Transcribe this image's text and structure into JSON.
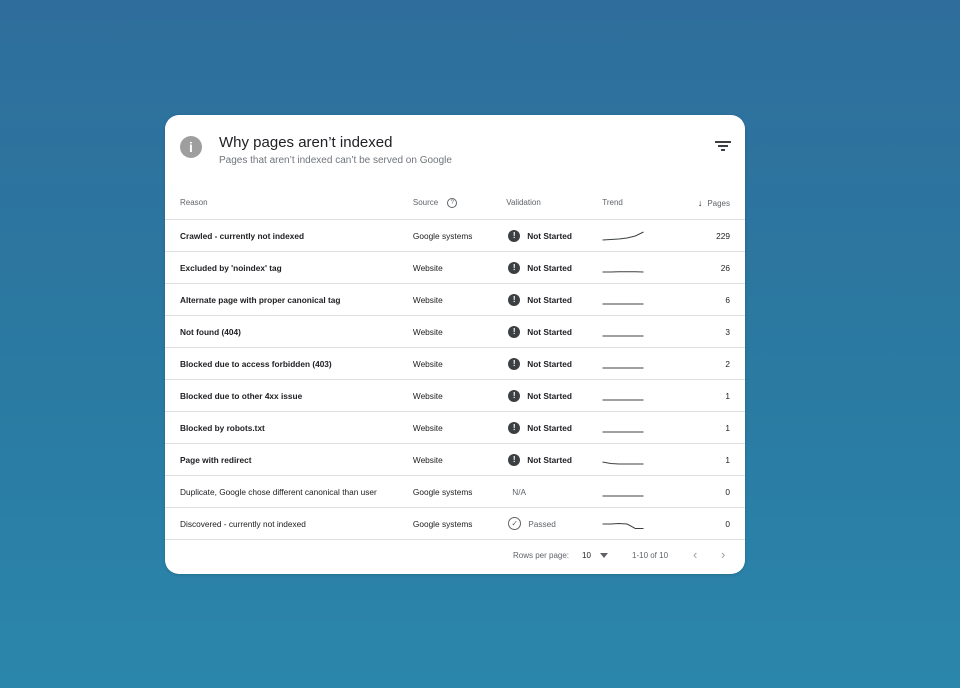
{
  "card": {
    "title": "Why pages aren’t indexed",
    "subtitle": "Pages that aren’t indexed can’t be served on Google",
    "info_icon": "info-icon",
    "filter_icon": "filter-icon"
  },
  "table": {
    "headers": {
      "reason": "Reason",
      "source": "Source",
      "validation": "Validation",
      "trend": "Trend",
      "pages": "Pages"
    },
    "sort_column": "Pages",
    "sort_direction": "descending",
    "rows": [
      {
        "reason": "Crawled - currently not indexed",
        "source": "Google systems",
        "validation": "Not Started",
        "validation_icon": "exclamation-icon",
        "pages": "229",
        "trend": [
          0.1,
          0.15,
          0.2,
          0.3,
          0.5,
          0.9
        ]
      },
      {
        "reason": "Excluded by 'noindex' tag",
        "source": "Website",
        "validation": "Not Started",
        "validation_icon": "exclamation-icon",
        "pages": "26",
        "trend": [
          0.1,
          0.1,
          0.12,
          0.12,
          0.12,
          0.1
        ]
      },
      {
        "reason": "Alternate page with proper canonical tag",
        "source": "Website",
        "validation": "Not Started",
        "validation_icon": "exclamation-icon",
        "pages": "6",
        "trend": [
          0.1,
          0.1,
          0.1,
          0.1,
          0.1,
          0.1
        ]
      },
      {
        "reason": "Not found (404)",
        "source": "Website",
        "validation": "Not Started",
        "validation_icon": "exclamation-icon",
        "pages": "3",
        "trend": [
          0.1,
          0.1,
          0.1,
          0.1,
          0.1,
          0.1
        ]
      },
      {
        "reason": "Blocked due to access forbidden (403)",
        "source": "Website",
        "validation": "Not Started",
        "validation_icon": "exclamation-icon",
        "pages": "2",
        "trend": [
          0.1,
          0.1,
          0.1,
          0.1,
          0.1,
          0.1
        ]
      },
      {
        "reason": "Blocked due to other 4xx issue",
        "source": "Website",
        "validation": "Not Started",
        "validation_icon": "exclamation-icon",
        "pages": "1",
        "trend": [
          0.1,
          0.1,
          0.1,
          0.1,
          0.1,
          0.1
        ]
      },
      {
        "reason": "Blocked by robots.txt",
        "source": "Website",
        "validation": "Not Started",
        "validation_icon": "exclamation-icon",
        "pages": "1",
        "trend": [
          0.1,
          0.1,
          0.1,
          0.1,
          0.1,
          0.1
        ]
      },
      {
        "reason": "Page with redirect",
        "source": "Website",
        "validation": "Not Started",
        "validation_icon": "exclamation-icon",
        "pages": "1",
        "trend": [
          0.3,
          0.15,
          0.1,
          0.1,
          0.1,
          0.1
        ]
      },
      {
        "reason": "Duplicate, Google chose different canonical than user",
        "source": "Google systems",
        "validation": "N/A",
        "validation_icon": "",
        "pages": "0",
        "trend": [
          0.1,
          0.1,
          0.1,
          0.1,
          0.1,
          0.1
        ]
      },
      {
        "reason": "Discovered - currently not indexed",
        "source": "Google systems",
        "validation": "Passed",
        "validation_icon": "check-circle-icon",
        "pages": "0",
        "trend": [
          0.5,
          0.5,
          0.55,
          0.5,
          0.05,
          0.05
        ]
      }
    ]
  },
  "footer": {
    "rows_per_page_label": "Rows per page:",
    "rows_per_page_value": "10",
    "range": "1-10 of 10",
    "prev_icon": "chevron-left-icon",
    "next_icon": "chevron-right-icon"
  },
  "colors": {
    "background_top": "#2f6e9c",
    "background_bottom": "#2b86ab",
    "card": "#ffffff",
    "status_icon": "#3c4043",
    "info_icon": "#9e9e9e"
  }
}
